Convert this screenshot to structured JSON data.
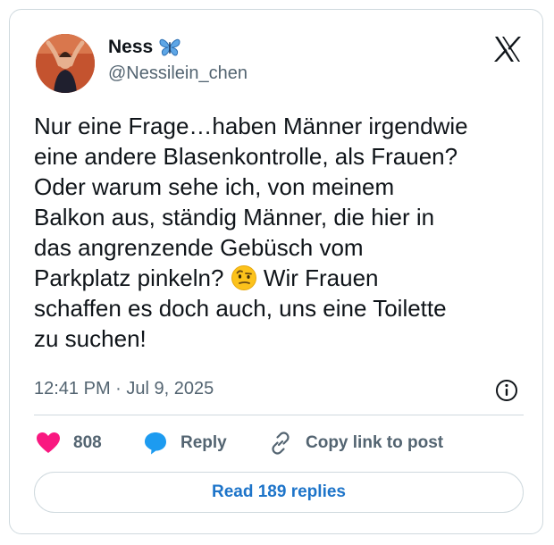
{
  "author": {
    "display_name": "Ness",
    "name_emoji": "butterfly-icon",
    "handle": "@Nessilein_chen"
  },
  "tweet": {
    "text_before_emoji": "Nur eine Frage…haben Männer irgendwie\neine andere Blasenkontrolle, als Frauen?\nOder warum sehe ich, von meinem\nBalkon aus, ständig Männer, die hier in\ndas angrenzende Gebüsch vom\nParkplatz pinkeln? ",
    "inline_emoji": "face-with-raised-eyebrow-icon",
    "text_after_emoji": " Wir Frauen\nschaffen es doch auch, uns eine Toilette\nzu suchen!",
    "timestamp": "12:41 PM · Jul 9, 2025"
  },
  "actions": {
    "like_count": "808",
    "reply_label": "Reply",
    "copy_label": "Copy link to post"
  },
  "footer": {
    "read_replies_label": "Read 189 replies"
  },
  "colors": {
    "like": "#f91880",
    "reply": "#1d9bf0",
    "link_text": "#1d74c9",
    "secondary_text": "#536471",
    "border": "#cfd9de"
  }
}
